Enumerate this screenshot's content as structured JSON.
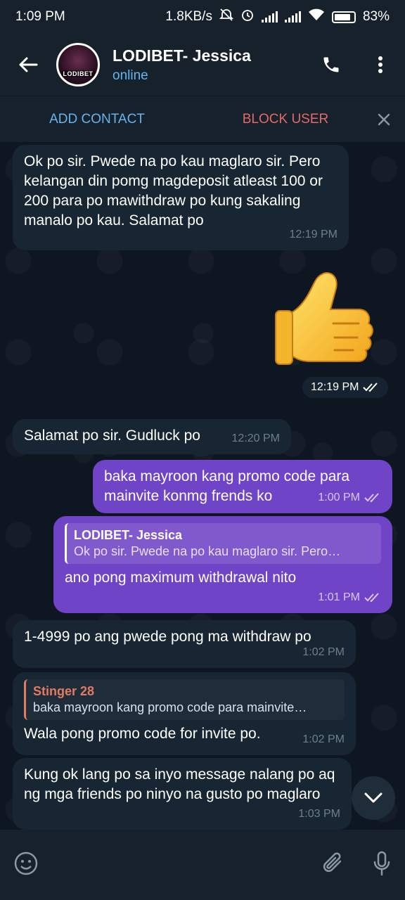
{
  "status_bar": {
    "time": "1:09 PM",
    "net_speed": "1.8KB/s",
    "battery": "83%"
  },
  "header": {
    "title": "LODIBET- Jessica",
    "subtitle": "online",
    "avatar_text": "LODIBET"
  },
  "action_bar": {
    "add_contact": "ADD CONTACT",
    "block_user": "BLOCK USER"
  },
  "messages": [
    {
      "dir": "in",
      "text": "Ok po sir. Pwede na po kau maglaro sir. Pero kelangan din pomg magdeposit atleast 100 or 200 para po mawithdraw po kung sakaling manalo po kau. Salamat po",
      "time": "12:19 PM"
    },
    {
      "dir": "out",
      "type": "sticker",
      "sticker": "thumbs-up",
      "time": "12:19 PM"
    },
    {
      "dir": "in",
      "text": "Salamat po sir. Gudluck po",
      "time": "12:20 PM"
    },
    {
      "dir": "out",
      "text": "baka mayroon kang promo code para mainvite konmg frends ko",
      "time": "1:00 PM"
    },
    {
      "dir": "out",
      "reply_name": "LODIBET- Jessica",
      "reply_text": "Ok po sir. Pwede na po kau maglaro sir. Pero…",
      "text": "ano pong maximum withdrawal nito",
      "time": "1:01 PM"
    },
    {
      "dir": "in",
      "text": "1-4999 po ang pwede pong ma withdraw po",
      "time": "1:02 PM"
    },
    {
      "dir": "in",
      "reply_name": "Stinger 28",
      "reply_text": "baka mayroon kang promo code para mainvite…",
      "text": "Wala pong promo code for invite po.",
      "time": "1:02 PM"
    },
    {
      "dir": "in",
      "text": "Kung ok lang po sa inyo message nalang po aq ng mga friends po ninyo na gusto po maglaro",
      "time": "1:03 PM"
    }
  ],
  "colors": {
    "accent_blue": "#64b5ef",
    "block_red": "#e26a6a",
    "outgoing_bubble": "#6f44c7",
    "incoming_bubble": "#182533",
    "background": "#0e1621"
  }
}
